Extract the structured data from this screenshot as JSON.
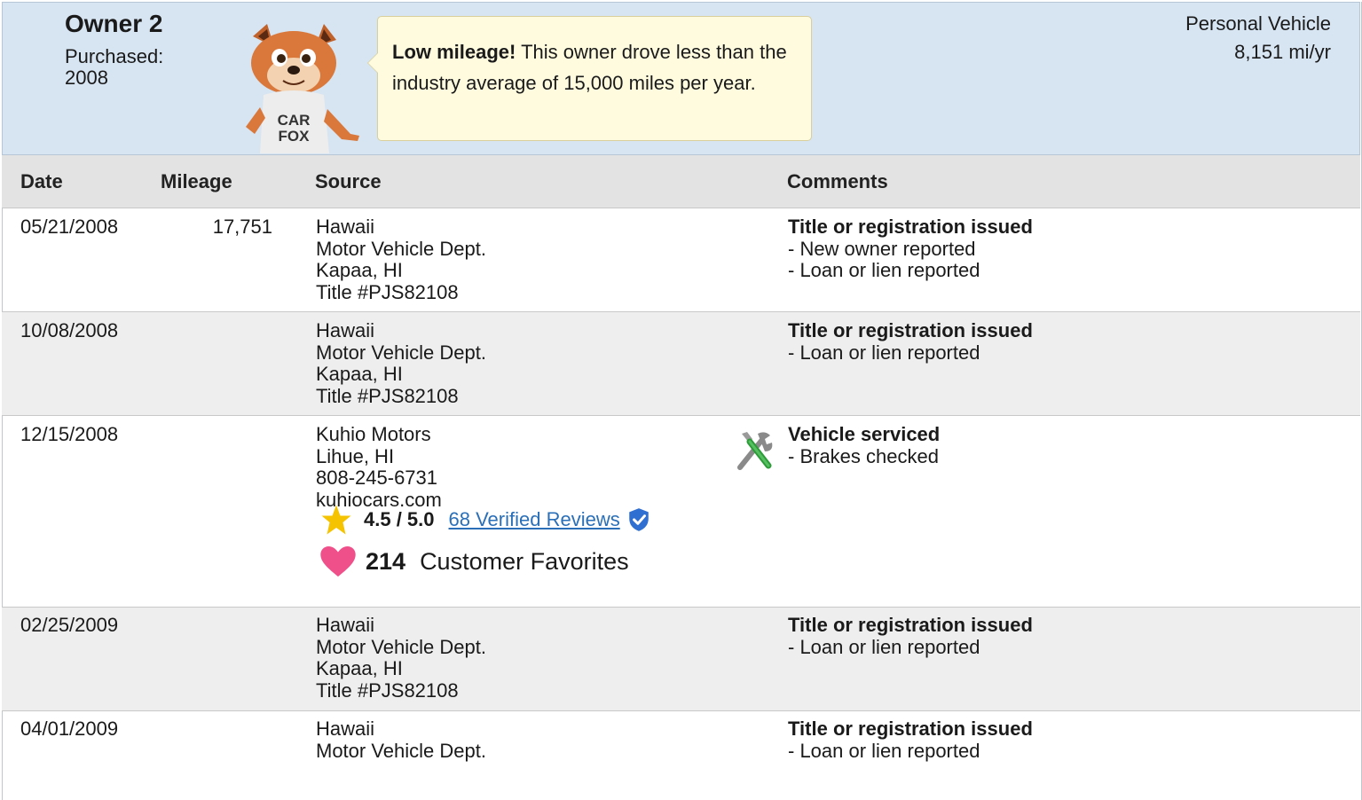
{
  "owner": {
    "title": "Owner 2",
    "purchased_label": "Purchased:",
    "purchased_year": "2008",
    "usage_type": "Personal Vehicle",
    "usage_rate": "8,151 mi/yr"
  },
  "mascot": {
    "shirt_line1": "CAR",
    "shirt_line2": "FOX"
  },
  "callout": {
    "bold": "Low mileage!",
    "text": " This owner drove less than the industry average of 15,000 miles per year."
  },
  "table": {
    "headers": {
      "date": "Date",
      "mileage": "Mileage",
      "source": "Source",
      "comments": "Comments"
    },
    "rows": [
      {
        "date": "05/21/2008",
        "mileage": "17,751",
        "source": [
          "Hawaii",
          "Motor Vehicle Dept.",
          "Kapaa, HI",
          "Title #PJS82108"
        ],
        "comment_title": "Title or registration issued",
        "comment_items": [
          "- New owner reported",
          "- Loan or lien reported"
        ]
      },
      {
        "date": "10/08/2008",
        "mileage": "",
        "source": [
          "Hawaii",
          "Motor Vehicle Dept.",
          "Kapaa, HI",
          "Title #PJS82108"
        ],
        "comment_title": "Title or registration issued",
        "comment_items": [
          "- Loan or lien reported"
        ]
      },
      {
        "date": "12/15/2008",
        "mileage": "",
        "source": [
          "Kuhio Motors",
          "Lihue, HI",
          "808-245-6731",
          "kuhiocars.com"
        ],
        "rating": {
          "score": "4.5 / 5.0",
          "reviews_link": "68 Verified Reviews"
        },
        "favorites": {
          "count": "214",
          "label": "Customer Favorites"
        },
        "comment_icon": "service-tools-icon",
        "comment_title": "Vehicle serviced",
        "comment_items": [
          "- Brakes checked"
        ]
      },
      {
        "date": "02/25/2009",
        "mileage": "",
        "source": [
          "Hawaii",
          "Motor Vehicle Dept.",
          "Kapaa, HI",
          "Title #PJS82108"
        ],
        "comment_title": "Title or registration issued",
        "comment_items": [
          "- Loan or lien reported"
        ]
      },
      {
        "date": "04/01/2009",
        "mileage": "",
        "source": [
          "Hawaii",
          "Motor Vehicle Dept."
        ],
        "comment_title": "Title or registration issued",
        "comment_items": [
          "- Loan or lien reported"
        ]
      }
    ]
  },
  "colors": {
    "header_bg": "#d7e4f2",
    "callout_bg": "#fffbdf",
    "link": "#2a6fb8",
    "star": "#f5c300",
    "heart": "#f0508a",
    "verified": "#2e6fd1"
  }
}
